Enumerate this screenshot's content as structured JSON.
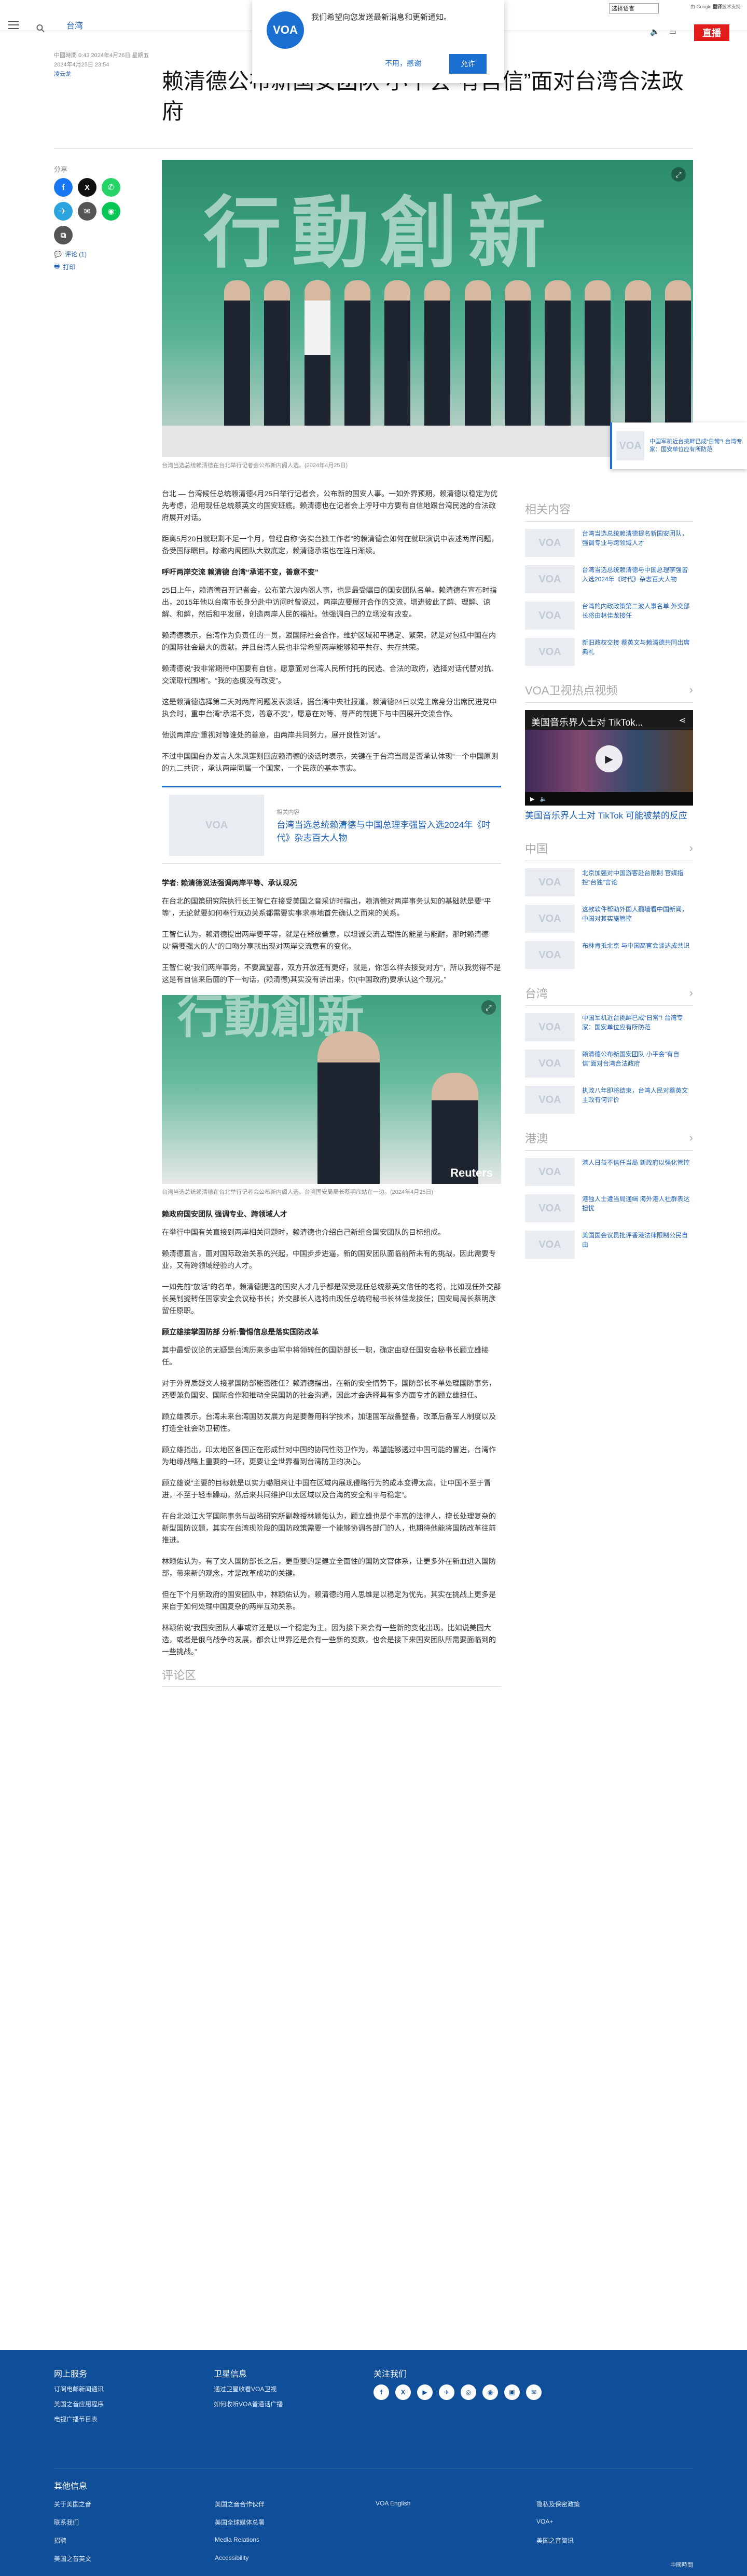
{
  "header": {
    "section": "台湾",
    "live_label": "直播",
    "language_select": "选择语言",
    "translate_note_prefix": "由 Google",
    "translate_note_brand": "翻译",
    "translate_note_suffix": "技术支持"
  },
  "notification": {
    "logo": "VOA",
    "message": "我们希望向您发送最新消息和更新通知。",
    "decline": "不用，感谢",
    "accept": "允许"
  },
  "article": {
    "meta_line": "中國時間 0:43 2024年4月26日 星期五",
    "date": "2024年4月25日 23:54",
    "author": "凌云龙",
    "title": "赖清德公布新国安团队 小平会“有自信”面对台湾合法政府",
    "hero_sign": "行動創新",
    "hero_caption": "台湾当选总统赖清德在台北举行记者会公布新内阁人选。(2024年4月25日)",
    "paragraphs_1": [
      "台北 — 台湾候任总统赖清德4月25日举行记者会，公布新的国安人事。一如外界预期，赖清德以稳定为优先考虑，沿用现任总统蔡英文的国安班底。赖清德也在记者会上呼吁中方要有自信地跟台湾民选的合法政府展开对话。",
      "距离5月20日就职剩不足一个月，曾经自称“务实台独工作者”的赖清德会如何在就职演说中表述两岸问题，备受国际瞩目。除邀内阁团队大致底定，赖清德承诺也在连日渐续。"
    ],
    "h_1": "呼吁两岸交流 赖清德 台湾“承诺不变，善意不变”",
    "paragraphs_2": [
      "25日上午，赖清德召开记者会，公布第六波内阁人事，也是最受瞩目的国安团队名单。赖清德在宣布时指出，2015年他以台南市长身分赴中访问时曾说过，两岸应要展开合作的交流，增进彼此了解、理解、谅解、和解，然后和平发展，创造两岸人民的福祉。他强调自己的立场没有改变。",
      "赖清德表示，台湾作为负责任的一员，跟国际社会合作，维护区域和平稳定、繁荣，就是对包括中国在内的国际社会最大的贡献。并且台湾人民也非常希望两岸能够和平共存、共存共荣。",
      "赖清德说“我非常期待中国要有自信，愿意面对台湾人民所付托的民选、合法的政府，选择对话代替对抗、交流取代围堵”。“我的态度没有改变”。",
      "这是赖清德选择第二天对两岸问题发表谈话，据台湾中央社报道，赖清德24日以党主席身分出席民进党中执会时，重申台湾“承诺不变，善意不变”，愿意在对等、尊严的前提下与中国展开交流合作。",
      "他说两岸应“重视对等谁处的善意，由两岸共同努力，展开良性对话”。",
      "不过中国国台办发言人朱凤莲则回应赖清德的谈话时表示，关键在于台湾当局是否承认体现“一个中国原则的九二共识”，承认两岸同属一个国家，一个民族的基本事实。"
    ],
    "related_label": "相关内容",
    "related_title": "台湾当选总统赖清德与中国总理李强皆入选2024年《时代》杂志百大人物",
    "h_2": "学者: 赖清德说法强调两岸平等、承认现况",
    "paragraphs_3": [
      "在台北的国策研究院执行长王智仁在接受美国之音采访时指出，赖清德对两岸事务认知的基础就是要“平等”，无论就要如何奉行双边关系都需要实事求事地首先确认之而来的关系。",
      "王智仁认为，赖清德提出两岸要平等，就是在释放善意，以坦诚交流去理性的能量与能耐，那时赖清德以“需要强大的人”的口吻分享就出现对两岸交流意有的变化。",
      "王智仁说“我们两岸事务，不要冀望喜，双方开放还有更好，就是，你怎么样去接受对方”，所以我觉得不是这是有自信来后面的下一句话，(赖清德)其实没有讲出来，你(中国政府)要承认这个现况。”"
    ],
    "inimg_caption": "台湾当选总统赖清德在台北举行记者会公布新内阁人选。台湾国安局局长蔡明彦站在一边。(2024年4月25日)",
    "inimg_stamp": "Reuters",
    "h_3": "赖政府国安团队 强调专业、跨领域人才",
    "paragraphs_4": [
      "在举行中国有关直接到两岸相关问题时，赖清德也介绍自己新组合国安团队的目标组成。",
      "赖清德直言，面对国际政治关系的兴起，中国步步进逼，新的国安团队面临前所未有的挑战，因此需要专业，又有跨领域经验的人才。",
      "一如先前“放话”的名单，赖清德提选的国安人才几乎都是深受现任总统蔡英文信任的老将，比如现任外交部长吴钊燮转任国家安全会议秘书长；外交部长人选将由现任总统府秘书长林佳龙接任；国安局局长蔡明彦留任原职。"
    ],
    "h_4": "顾立雄接掌国防部 分析:警惕信息是落实国防改革",
    "paragraphs_5": [
      "其中最受议论的无疑是台湾历来多由军中将领转任的国防部长一职，确定由现任国安会秘书长顾立雄接任。",
      "对于外界质疑文人接掌国防部能否胜任？赖清德指出，在新的安全情势下，国防部长不单处理国防事务，还要兼负国安、国际合作和推动全民国防的社会沟通，因此才会选择具有多方面专才的顾立雄担任。",
      "顾立雄表示，台湾未来台湾国防发展方向是要善用科学技术，加速国军战备整备，改革后备军人制度以及打造全社会防卫韧性。",
      "顾立雄指出，印太地区各国正在形成针对中国的协同性防卫作为，希望能够透过中国可能的冒进，台湾作为地缘战略上重要的一环，更要让全世界看到台湾防卫的决心。",
      "顾立雄说“主要的目标就是以实力嚇阻来让中国在区域内展现侵略行为的成本变得太高，让中国不至于冒进，不至于轻率躁动，然后来共同维护印太区域以及台海的安全和平与稳定”。",
      "在台北淡江大学国际事务与战略研究所副教授林颖佑认为，顾立雄也是个丰富的法律人，擅长处理复杂的新型国防议题，其实在台湾现阶段的国防政策需要一个能够协调各部门的人，也期待他能将国防改革往前推进。",
      "林颖佑认为，有了文人国防部长之后，更重要的是建立全面性的国防文官体系，让更多外在新血进入国防部，带来新的观念，才是改革成功的关键。",
      "但在下个月新政府的国安团队中，林颖佑认为，赖清德的用人思维是以稳定为优先，其实在挑战上更多是来自于如何处理中国复杂的两岸互动关系。",
      "林颖佑说“我国安团队人事或许还是以一个稳定为主，因为接下来会有一些新的变化出现，比如说美国大选，或者是俄乌战争的发展，都会让世界还是会有一些新的变数，也会是接下来国安团队所需要面临到的一些挑战。”"
    ],
    "comments_label": "评论区"
  },
  "share": {
    "label": "分享",
    "comments_link": "评论 (1)",
    "print_link": "打印"
  },
  "float_card": {
    "text": "中国军机近台挑衅已成“日常”! 台湾专家：国安单位应有所防范"
  },
  "sidebar": {
    "related_heading": "相关内容",
    "related_items": [
      "台湾当选总统赖清德提名新国安团队，强调专业与跨领域人才",
      "台湾当选总统赖清德与中国总理李强皆入选2024年《时代》杂志百大人物",
      "台湾的内政政策第二波人事名单 外交部长将由林佳龙接任",
      "新旧政权交接 蔡英文与赖清德共同出席典礼"
    ],
    "video_heading": "VOA卫视热点视频",
    "video_overlay_title": "美国音乐界人士对 TikTok...",
    "video_title": "美国音乐界人士对 TikTok 可能被禁的反应",
    "china_heading": "中国",
    "china_items": [
      "北京加强对中国游客赴台限制 官媒指控“台独”言论",
      "这款软件帮助外国人翻墙看中国新闻，中国对其实施管控",
      "布林肯抵北京 与中国高官会谈达成共识"
    ],
    "taiwan_heading": "台湾",
    "taiwan_items": [
      "中国军机近台挑衅已成“日常”! 台湾专家：国安单位应有所防范",
      "赖清德公布新国安团队 小平会“有自信”面对台湾合法政府",
      "执政八年即将结束，台湾人民对蔡英文主政有何评价"
    ],
    "hk_heading": "港澳",
    "hk_items": [
      "港人日益不信任当局 新政府以强化管控",
      "港独人士遭当局通缉 海外港人社群表达担忧",
      "美国国会议员批评香港法律限制公民自由"
    ]
  },
  "footer": {
    "col1_heading": "网上服务",
    "col1_links": [
      "订阅电邮新闻通讯",
      "美国之音应用程序",
      "电视广播节目表"
    ],
    "col2_heading": "卫星信息",
    "col2_links": [
      "通过卫星收看VOA卫视",
      "如何收听VOA普通话广播"
    ],
    "col3_heading": "关注我们",
    "social": [
      "f",
      "X",
      "▶",
      "✈",
      "◎",
      "◉",
      "▣",
      "✉"
    ],
    "others_heading": "其他信息",
    "others_links": [
      "关于美国之音",
      "美国之音合作伙伴",
      "VOA English",
      "隐私及保密政策",
      "联系我们",
      "美国全球媒体总署",
      "",
      "VOA+",
      "招聘",
      "Media Relations",
      "",
      "美国之音简讯",
      "美国之音英文",
      "Accessibility",
      ""
    ],
    "copyright": "中國時間"
  }
}
